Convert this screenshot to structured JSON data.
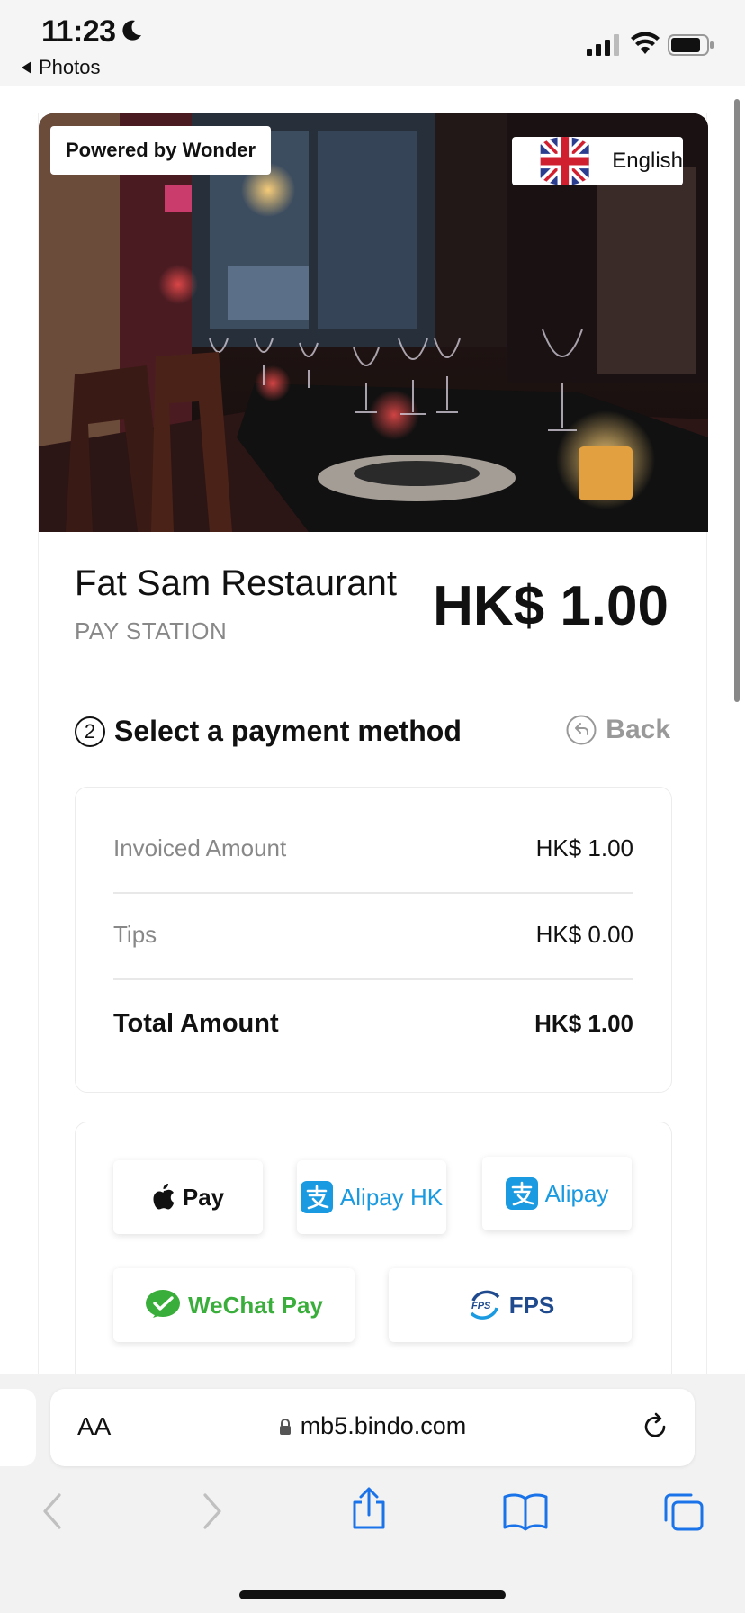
{
  "status_bar": {
    "time": "11:23",
    "back_app": "Photos"
  },
  "hero": {
    "powered_by": "Powered by Wonder",
    "language": "English"
  },
  "merchant": {
    "name": "Fat Sam Restaurant",
    "subtitle": "PAY STATION",
    "amount": "HK$ 1.00"
  },
  "step": {
    "number": "2",
    "title": "Select a payment method",
    "back_label": "Back"
  },
  "summary": {
    "invoiced_label": "Invoiced Amount",
    "invoiced_value": "HK$ 1.00",
    "tips_label": "Tips",
    "tips_value": "HK$ 0.00",
    "total_label": "Total Amount",
    "total_value": "HK$ 1.00"
  },
  "payment_methods": {
    "apple_pay": "Pay",
    "alipay_hk": "Alipay HK",
    "alipay": "Alipay",
    "wechat_pay": "WeChat Pay",
    "fps": "FPS",
    "fps_mark": "FPS"
  },
  "safari": {
    "aa_label": "AA",
    "url": "mb5.bindo.com"
  },
  "colors": {
    "alipay_blue": "#1a9ae0",
    "wechat_green": "#3aae3a",
    "fps_navy": "#1f4a8e"
  }
}
